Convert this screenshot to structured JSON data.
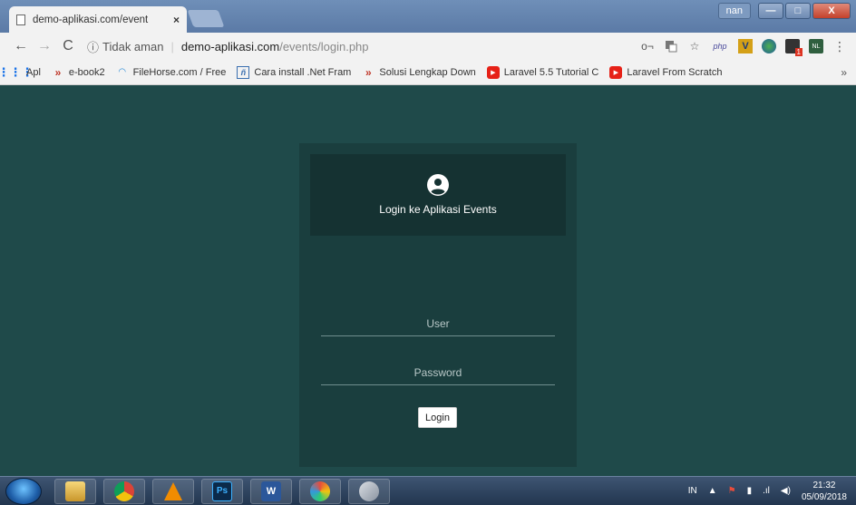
{
  "browser": {
    "tab_title": "demo-aplikasi.com/event",
    "tab_close": "×",
    "user_chip": "nan",
    "window_buttons": {
      "minimize": "—",
      "maximize": "□",
      "close": "X"
    }
  },
  "address_bar": {
    "back": "←",
    "forward": "→",
    "reload": "C",
    "info_icon": "ⓘ",
    "security": "Tidak aman",
    "separator": "|",
    "host": "demo-aplikasi.com",
    "path": "/events/login.php",
    "icons": [
      "key-icon",
      "translate-icon",
      "star-icon",
      "php-icon",
      "v-extension-icon",
      "globe-icon",
      "extension-icon",
      "nl-icon",
      "menu-icon"
    ],
    "ext_badge": "1",
    "php_label": "php",
    "v_label": "V",
    "nl_label": "NL",
    "menu_label": "⋮",
    "star_label": "☆",
    "key_label": "o¬"
  },
  "bookmarks": {
    "items": [
      {
        "icon": "apps-grid-icon",
        "label": "Apl"
      },
      {
        "icon": "chevron-icon",
        "label": "e-book2"
      },
      {
        "icon": "filehorse-icon",
        "label": "FileHorse.com / Free"
      },
      {
        "icon": "box-icon",
        "label": "Cara install .Net Fram"
      },
      {
        "icon": "chevron-icon",
        "label": "Solusi Lengkap Down"
      },
      {
        "icon": "youtube-icon",
        "label": "Laravel 5.5 Tutorial C"
      },
      {
        "icon": "youtube-icon",
        "label": "Laravel From Scratch"
      }
    ],
    "more": "»"
  },
  "login": {
    "title": "Login ke Aplikasi Events",
    "user_placeholder": "User",
    "password_placeholder": "Password",
    "button": "Login"
  },
  "taskbar": {
    "apps": [
      "explorer-icon",
      "chrome-icon",
      "vlc-icon",
      "photoshop-icon",
      "word-icon",
      "paint-icon",
      "snipping-tool-icon"
    ],
    "ps_label": "Ps",
    "word_label": "W",
    "language": "IN",
    "time": "21:32",
    "date": "05/09/2018"
  },
  "colors": {
    "page_bg": "#1f4a4a",
    "card_bg": "#1a3e3e",
    "card_head_bg": "#153232"
  }
}
